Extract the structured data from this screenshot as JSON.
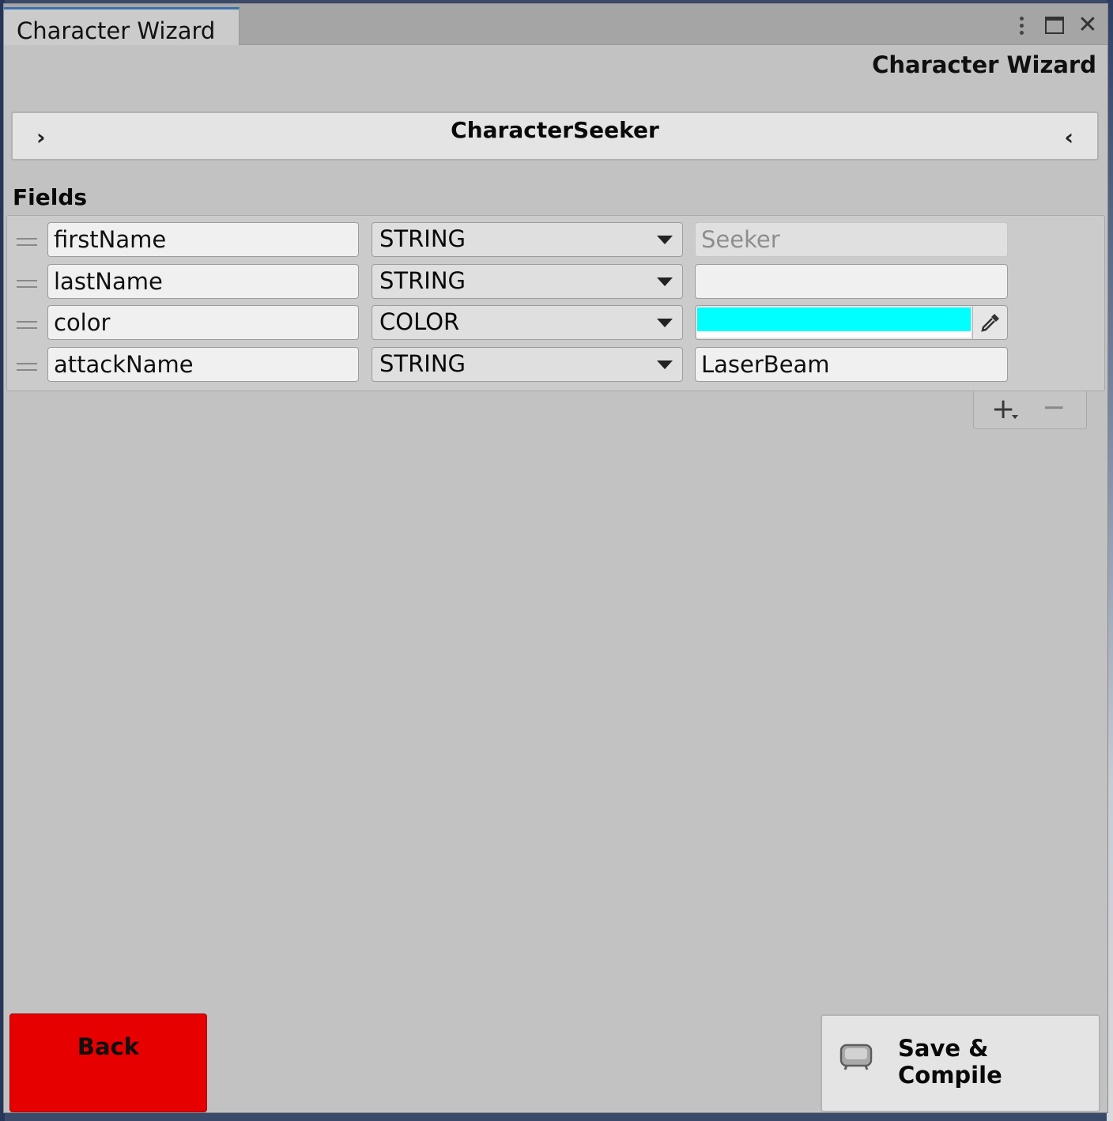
{
  "window": {
    "tab_label": "Character Wizard",
    "heading": "Character Wizard"
  },
  "seeker": {
    "title": "CharacterSeeker",
    "prev_glyph": "›",
    "next_glyph": "‹"
  },
  "fields": {
    "label": "Fields",
    "rows": [
      {
        "name": "firstName",
        "type": "STRING",
        "value_kind": "text",
        "value": "Seeker",
        "value_placeholder": true
      },
      {
        "name": "lastName",
        "type": "STRING",
        "value_kind": "text",
        "value": "",
        "value_placeholder": false
      },
      {
        "name": "color",
        "type": "COLOR",
        "value_kind": "color",
        "value": "#00ffff",
        "value_placeholder": false
      },
      {
        "name": "attackName",
        "type": "STRING",
        "value_kind": "text",
        "value": "LaserBeam",
        "value_placeholder": false
      }
    ]
  },
  "list_controls": {
    "add_glyph": "+",
    "remove_glyph": "−"
  },
  "footer": {
    "back_label": "Back",
    "save_label": "Save & Compile",
    "back_color": "#e60000"
  },
  "icons": {
    "kebab": "more-vertical-icon",
    "maximize": "maximize-icon",
    "close": "close-icon",
    "eyedropper": "eyedropper-icon",
    "save": "save-compile-icon"
  }
}
